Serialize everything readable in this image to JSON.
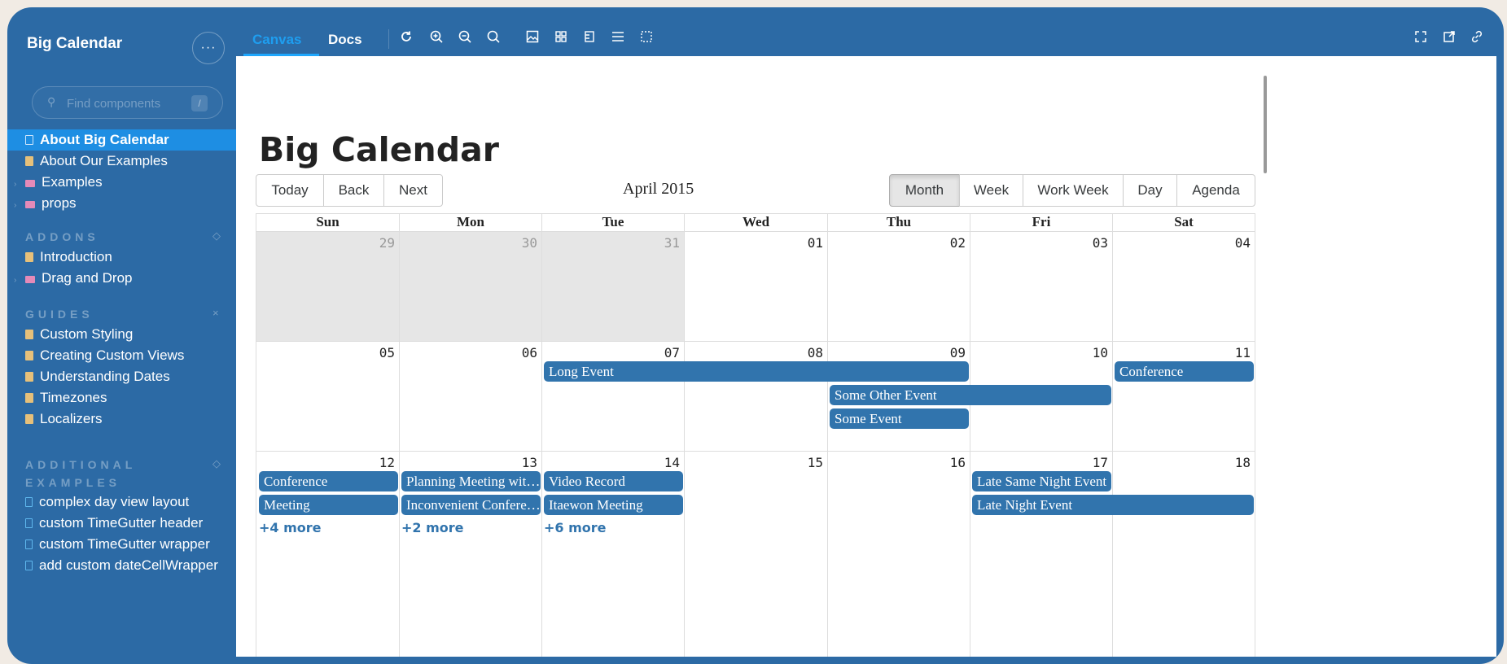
{
  "sidebar": {
    "title": "Big Calendar",
    "more_label": "···",
    "search": {
      "placeholder": "Find components",
      "shortcut": "/"
    },
    "items": [
      {
        "label": "About Big Calendar",
        "type": "doc",
        "active": true
      },
      {
        "label": "About Our Examples",
        "type": "doc"
      },
      {
        "label": "Examples",
        "type": "folder"
      },
      {
        "label": "props",
        "type": "folder"
      }
    ],
    "groups": [
      {
        "title": "ADDONS",
        "items": [
          {
            "label": "Introduction",
            "type": "doc"
          },
          {
            "label": "Drag and Drop",
            "type": "folder"
          }
        ]
      },
      {
        "title": "GUIDES",
        "items": [
          {
            "label": "Custom Styling",
            "type": "doc"
          },
          {
            "label": "Creating Custom Views",
            "type": "doc"
          },
          {
            "label": "Understanding Dates",
            "type": "doc"
          },
          {
            "label": "Timezones",
            "type": "doc"
          },
          {
            "label": "Localizers",
            "type": "doc"
          }
        ]
      },
      {
        "title": "ADDITIONAL EXAMPLES",
        "items": [
          {
            "label": "complex day view layout",
            "type": "component"
          },
          {
            "label": "custom TimeGutter header",
            "type": "component"
          },
          {
            "label": "custom TimeGutter wrapper",
            "type": "component"
          },
          {
            "label": "add custom dateCellWrapper",
            "type": "component"
          }
        ]
      }
    ]
  },
  "toolbar": {
    "tabs": [
      "Canvas",
      "Docs"
    ],
    "active_tab": "Canvas",
    "icons": [
      "reload-icon",
      "zoom-in-icon",
      "zoom-out-icon",
      "zoom-reset-icon",
      "background-icon",
      "grid-icon",
      "measure-icon",
      "outline-icon",
      "viewport-icon"
    ],
    "right_icons": [
      "fullscreen-icon",
      "open-new-tab-icon",
      "copy-link-icon"
    ]
  },
  "page": {
    "title": "Big Calendar",
    "nav_buttons": [
      "Today",
      "Back",
      "Next"
    ],
    "month_label": "April 2015",
    "view_buttons": [
      "Month",
      "Week",
      "Work Week",
      "Day",
      "Agenda"
    ],
    "active_view": "Month"
  },
  "calendar": {
    "weekdays": [
      "Sun",
      "Mon",
      "Tue",
      "Wed",
      "Thu",
      "Fri",
      "Sat"
    ],
    "weeks": [
      {
        "days": [
          "29",
          "30",
          "31",
          "01",
          "02",
          "03",
          "04"
        ],
        "off": [
          true,
          true,
          true,
          false,
          false,
          false,
          false
        ],
        "events": [],
        "more": []
      },
      {
        "days": [
          "05",
          "06",
          "07",
          "08",
          "09",
          "10",
          "11"
        ],
        "off": [
          false,
          false,
          false,
          false,
          false,
          false,
          false
        ],
        "events": [
          {
            "title": "Long Event",
            "start": 2,
            "span": 3,
            "row": 0
          },
          {
            "title": "Conference",
            "start": 6,
            "span": 1,
            "row": 0
          },
          {
            "title": "Some Other Event",
            "start": 4,
            "span": 2,
            "row": 1
          },
          {
            "title": "Some Event",
            "start": 4,
            "span": 1,
            "row": 2
          }
        ],
        "more": []
      },
      {
        "days": [
          "12",
          "13",
          "14",
          "15",
          "16",
          "17",
          "18"
        ],
        "off": [
          false,
          false,
          false,
          false,
          false,
          false,
          false
        ],
        "events": [
          {
            "title": "Conference",
            "start": 0,
            "span": 1,
            "row": 0
          },
          {
            "title": "Planning Meeting with Paige",
            "start": 1,
            "span": 1,
            "row": 0
          },
          {
            "title": "Video Record",
            "start": 2,
            "span": 1,
            "row": 0
          },
          {
            "title": "Late Same Night Event",
            "start": 5,
            "span": 1,
            "row": 0
          },
          {
            "title": "Meeting",
            "start": 0,
            "span": 1,
            "row": 1
          },
          {
            "title": "Inconvenient Conference Call",
            "start": 1,
            "span": 1,
            "row": 1
          },
          {
            "title": "Itaewon Meeting",
            "start": 2,
            "span": 1,
            "row": 1
          },
          {
            "title": "Late Night Event",
            "start": 5,
            "span": 2,
            "row": 1
          }
        ],
        "more": [
          {
            "label": "+4 more",
            "col": 0
          },
          {
            "label": "+2 more",
            "col": 1
          },
          {
            "label": "+6 more",
            "col": 2
          }
        ]
      }
    ]
  },
  "colors": {
    "frame": "#2c6aa5",
    "active_item": "#1e8ee3",
    "accent_tab": "#1e9ef0",
    "event": "#3174ad",
    "off_range": "#e6e6e6"
  }
}
